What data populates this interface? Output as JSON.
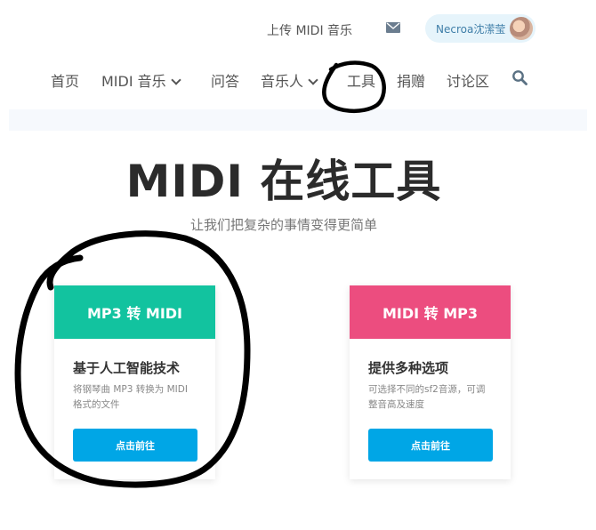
{
  "header": {
    "upload_label": "上传 MIDI 音乐",
    "user_name": "Necroa沈潆莹"
  },
  "nav": {
    "items": [
      {
        "label": "首页"
      },
      {
        "label": "MIDI 音乐"
      },
      {
        "label": "问答"
      },
      {
        "label": "音乐人"
      },
      {
        "label": "工具"
      },
      {
        "label": "捐赠"
      },
      {
        "label": "讨论区"
      }
    ]
  },
  "hero": {
    "title": "MIDI 在线工具",
    "subtitle": "让我们把复杂的事情变得更简单"
  },
  "cards": [
    {
      "header": "MP3 转 MIDI",
      "title": "基于人工智能技术",
      "description": "将钢琴曲 MP3 转换为 MIDI 格式的文件",
      "button": "点击前往",
      "color": "#12c39f"
    },
    {
      "header": "MIDI 转 MP3",
      "title": "提供多种选项",
      "description": "可选择不同的sf2音源，可调整音高及速度",
      "button": "点击前往",
      "color": "#ec4d7f"
    }
  ],
  "icons": {
    "mail": "envelope-icon",
    "search": "magnifier-icon",
    "dropdown": "chevron-down-icon"
  },
  "colors": {
    "accent": "#00a6e6",
    "annotation": "#000000"
  }
}
